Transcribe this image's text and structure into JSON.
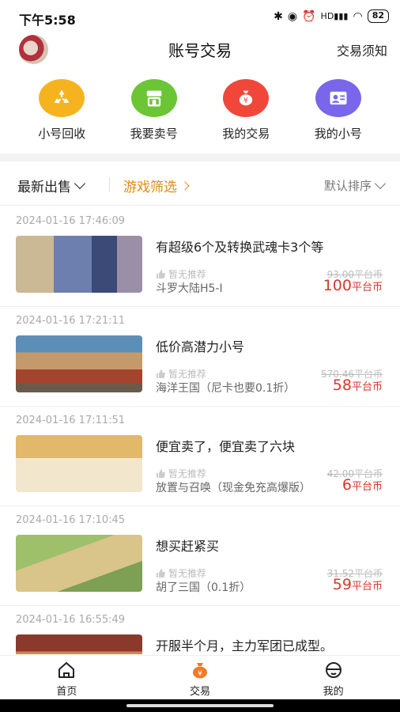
{
  "status_bar": {
    "time": "下午5:58",
    "battery": "82",
    "signal_label": "HD"
  },
  "header": {
    "title": "账号交易",
    "right_link": "交易须知"
  },
  "quick_nav": [
    {
      "label": "小号回收",
      "icon": "recycle-icon",
      "color": "#f5b41f"
    },
    {
      "label": "我要卖号",
      "icon": "shop-icon",
      "color": "#6cc535"
    },
    {
      "label": "我的交易",
      "icon": "money-bag-icon",
      "color": "#f0473a"
    },
    {
      "label": "我的小号",
      "icon": "user-card-icon",
      "color": "#7a66ea"
    }
  ],
  "filters": {
    "latest": "最新出售",
    "game_filter": "游戏筛选",
    "sort": "默认排序"
  },
  "listings": [
    {
      "date": "2024-01-16 17:46:09",
      "title": "有超级6个及转换武魂卡3个等",
      "recommend": "暂无推荐",
      "game": "斗罗大陆H5-I",
      "original_price": "93.00平台币",
      "price": "100",
      "unit": "平台币"
    },
    {
      "date": "2024-01-16 17:21:11",
      "title": "低价高潜力小号",
      "recommend": "暂无推荐",
      "game": "海洋王国（尼卡也要0.1折）",
      "original_price": "570.46平台币",
      "price": "58",
      "unit": "平台币"
    },
    {
      "date": "2024-01-16 17:11:51",
      "title": "便宜卖了，便宜卖了六块",
      "recommend": "暂无推荐",
      "game": "放置与召唤（现金免充高爆版）",
      "original_price": "42.00平台币",
      "price": "6",
      "unit": "平台币"
    },
    {
      "date": "2024-01-16 17:10:45",
      "title": "想买赶紧买",
      "recommend": "暂无推荐",
      "game": "胡了三国（0.1折）",
      "original_price": "31.52平台币",
      "price": "59",
      "unit": "平台币"
    },
    {
      "date": "2024-01-16 16:55:49",
      "title": "开服半个月，主力军团已成型。"
    }
  ],
  "bottom_nav": [
    {
      "label": "首页",
      "icon": "home-icon"
    },
    {
      "label": "交易",
      "icon": "trade-icon",
      "active_color": "#f07a2a"
    },
    {
      "label": "我的",
      "icon": "profile-icon"
    }
  ]
}
